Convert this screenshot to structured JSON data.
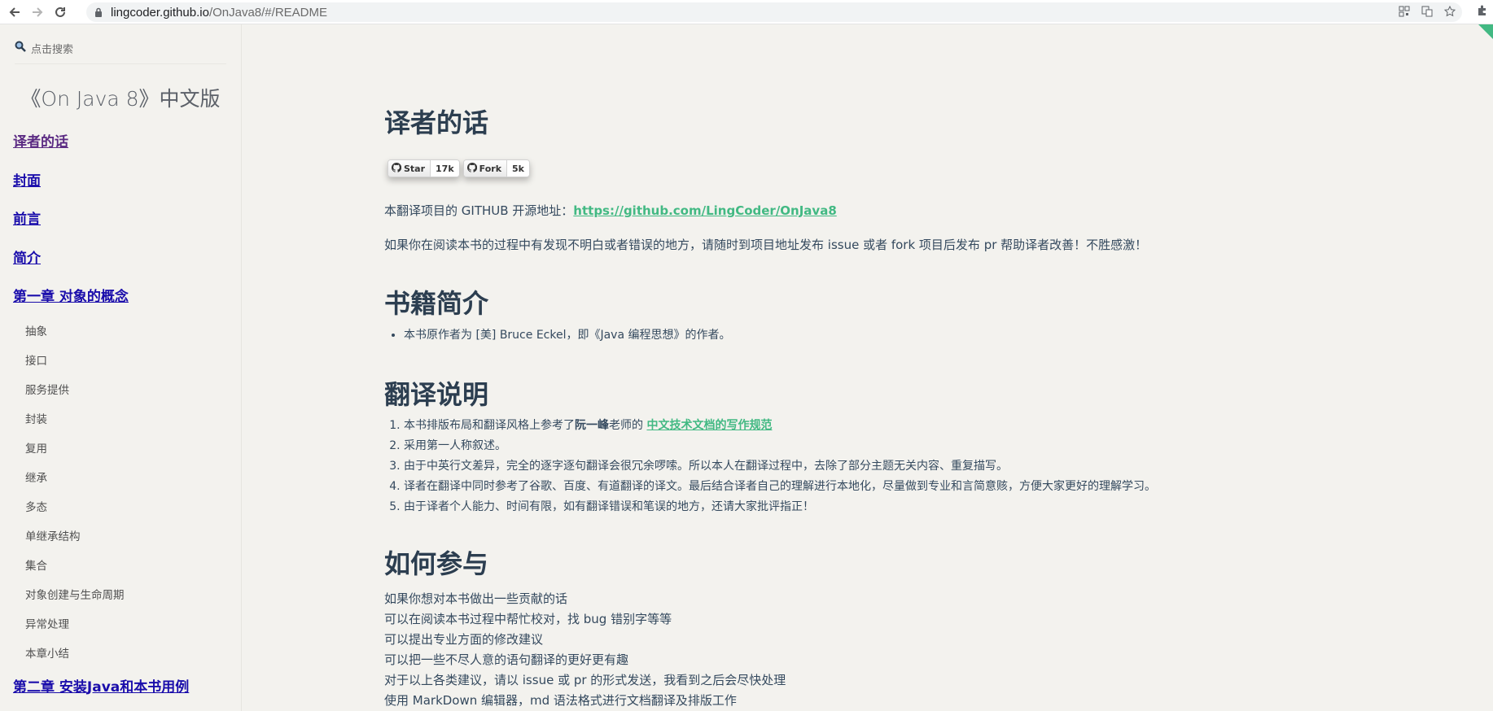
{
  "browser": {
    "url_host": "lingcoder.github.io",
    "url_path": "/OnJava8/#/README"
  },
  "sidebar": {
    "search_placeholder": "点击搜索",
    "app_name": "《On Java 8》中文版",
    "items": [
      {
        "label": "译者的话",
        "type": "chapter",
        "visited": true
      },
      {
        "label": "封面",
        "type": "chapter"
      },
      {
        "label": "前言",
        "type": "chapter"
      },
      {
        "label": "简介",
        "type": "chapter"
      },
      {
        "label": "第一章 对象的概念",
        "type": "chapter"
      },
      {
        "label": "抽象",
        "type": "section"
      },
      {
        "label": "接口",
        "type": "section"
      },
      {
        "label": "服务提供",
        "type": "section"
      },
      {
        "label": "封装",
        "type": "section"
      },
      {
        "label": "复用",
        "type": "section"
      },
      {
        "label": "继承",
        "type": "section"
      },
      {
        "label": "多态",
        "type": "section"
      },
      {
        "label": "单继承结构",
        "type": "section"
      },
      {
        "label": "集合",
        "type": "section"
      },
      {
        "label": "对象创建与生命周期",
        "type": "section"
      },
      {
        "label": "异常处理",
        "type": "section"
      },
      {
        "label": "本章小结",
        "type": "section"
      },
      {
        "label": "第二章 安装Java和本书用例",
        "type": "chapter"
      }
    ]
  },
  "main": {
    "title": "译者的话",
    "badges": {
      "star_label": "Star",
      "star_count": "17k",
      "fork_label": "Fork",
      "fork_count": "5k"
    },
    "repo_prefix": "本翻译项目的 GITHUB 开源地址：",
    "repo_link": "https://github.com/LingCoder/OnJava8",
    "feedback": "如果你在阅读本书的过程中有发现不明白或者错误的地方，请随时到项目地址发布 issue 或者 fork 项目后发布 pr 帮助译者改善！不胜感激！",
    "book_heading": "书籍简介",
    "book_items": [
      "本书原作者为 [美] Bruce Eckel，即《Java 编程思想》的作者。"
    ],
    "translation_heading": "翻译说明",
    "translation_item1_prefix": "本书排版布局和翻译风格上参考了",
    "translation_item1_name": "阮一峰",
    "translation_item1_mid": "老师的 ",
    "translation_item1_link": "中文技术文档的写作规范",
    "translation_items": [
      "采用第一人称叙述。",
      "由于中英行文差异，完全的逐字逐句翻译会很冗余啰嗦。所以本人在翻译过程中，去除了部分主题无关内容、重复描写。",
      "译者在翻译中同时参考了谷歌、百度、有道翻译的译文。最后结合译者自己的理解进行本地化，尽量做到专业和言简意赅，方便大家更好的理解学习。",
      "由于译者个人能力、时间有限，如有翻译错误和笔误的地方，还请大家批评指正！"
    ],
    "join_heading": "如何参与",
    "join_lines": [
      "如果你想对本书做出一些贡献的话",
      "可以在阅读本书过程中帮忙校对，找 bug 错别字等等",
      "可以提出专业方面的修改建议",
      "可以把一些不尽人意的语句翻译的更好更有趣",
      "对于以上各类建议，请以 issue 或 pr 的形式发送，我看到之后会尽快处理",
      "使用 MarkDown 编辑器，md 语法格式进行文档翻译及排版工作"
    ]
  },
  "colors": {
    "background": "#f3f2ee",
    "accent": "#42b983",
    "link_blue": "#1a0dab",
    "link_visited": "#5b2b83",
    "heading": "#2c3e50"
  }
}
